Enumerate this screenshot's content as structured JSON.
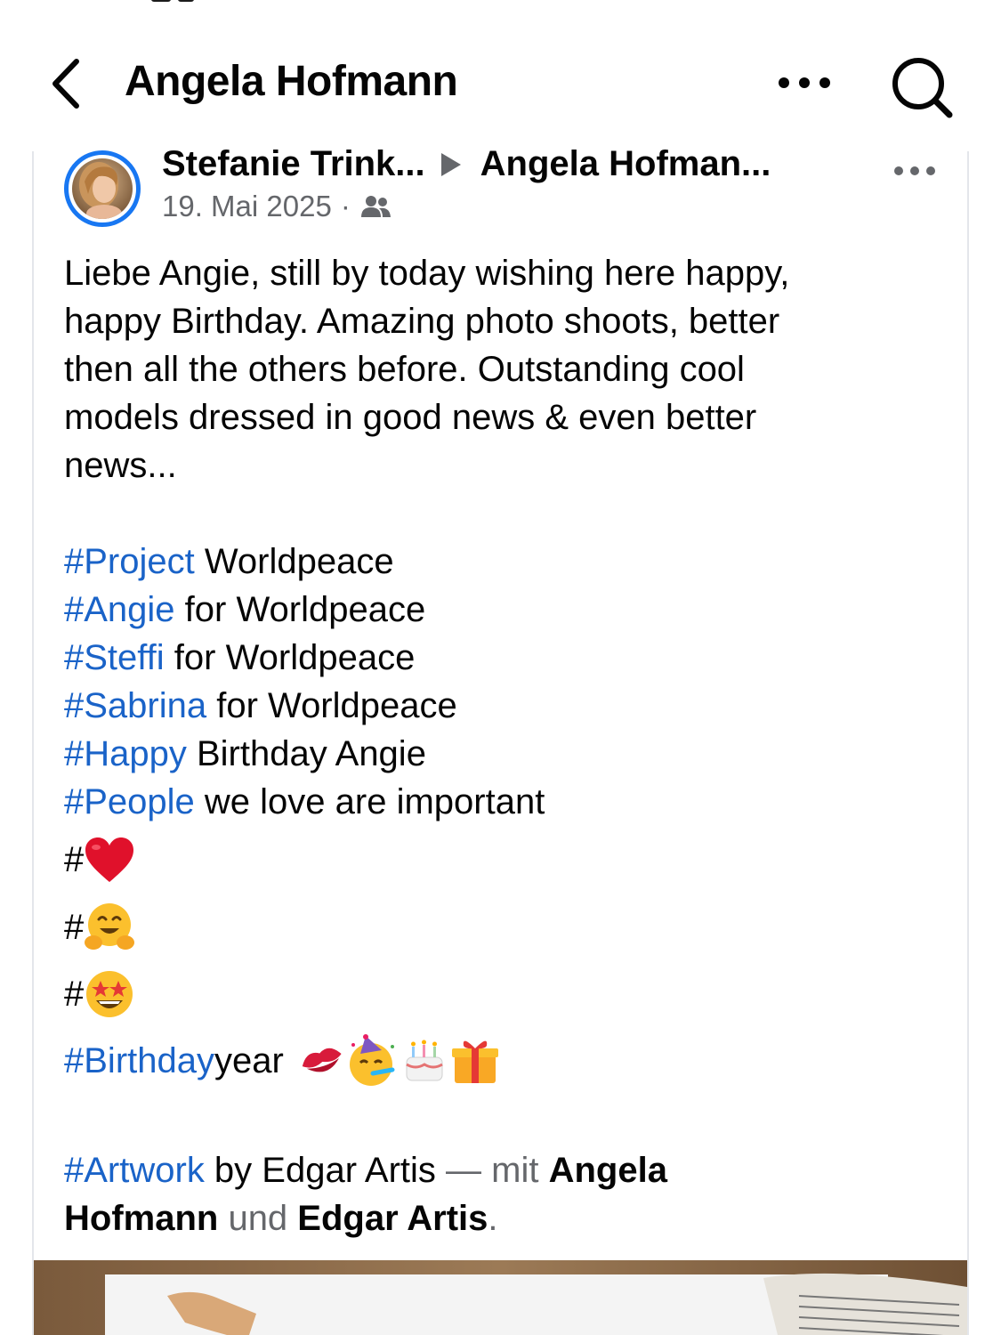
{
  "header": {
    "title": "Angela Hofmann",
    "icons": {
      "back": "chevron-left-icon",
      "more": "more-horizontal-icon",
      "search": "search-icon"
    }
  },
  "post": {
    "author": "Stefanie Trink...",
    "target": "Angela Hofman...",
    "date": "19. Mai 2025",
    "separator": "·",
    "audience_icon": "friends-icon",
    "text_lines": [
      "Liebe Angie, still by today wishing here happy,",
      "happy Birthday. Amazing photo shoots, better",
      "then all the others before. Outstanding cool",
      "models dressed in good news & even better",
      "news..."
    ],
    "hashtag_lines": [
      {
        "tag": "#Project",
        "rest": " Worldpeace"
      },
      {
        "tag": "#Angie",
        "rest": " for Worldpeace"
      },
      {
        "tag": "#Steffi",
        "rest": " for Worldpeace"
      },
      {
        "tag": "#Sabrina",
        "rest": " for Worldpeace"
      },
      {
        "tag": "#Happy",
        "rest": " Birthday Angie"
      },
      {
        "tag": "#People",
        "rest": " we love are important"
      }
    ],
    "emoji_tags": [
      {
        "hash": "#",
        "emoji": "heart"
      },
      {
        "hash": "#",
        "emoji": "hugging-face"
      },
      {
        "hash": "#",
        "emoji": "star-struck"
      }
    ],
    "birthday_line": {
      "tag": "#Birthday",
      "rest": " year",
      "emojis": [
        "kiss-mark",
        "partying-face",
        "birthday-cake",
        "wrapped-gift"
      ]
    },
    "credit": {
      "tag": "#Artwork",
      "rest": " by Edgar Artis",
      "dash": " — mit ",
      "person1_line1": "Angela",
      "person1_line2": "Hofmann",
      "and": " und ",
      "person2": "Edgar Artis",
      "period": "."
    }
  },
  "colors": {
    "hashtag": "#1a63c8",
    "text": "#050505",
    "muted": "#65676b",
    "accent": "#1877f2"
  }
}
